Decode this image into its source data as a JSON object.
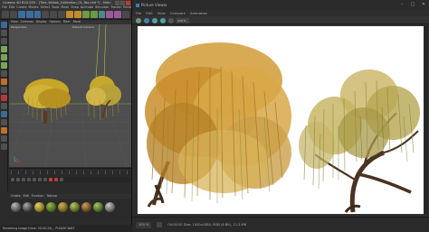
{
  "app": {
    "title": "Cinema 4D R20.059 - [Tree_Willow_Collection_01_fbx.c4d *] - Main",
    "menu": [
      "File",
      "Edit",
      "Create",
      "Modes",
      "Select",
      "Tools",
      "Mesh",
      "Snap",
      "Animate",
      "Simulate",
      "Tracker",
      "Render",
      "Sculpt",
      "Motion Tracker",
      "MoGraph",
      "Character",
      "Pipeline",
      "Plugins",
      "Script",
      "Window",
      "Help"
    ],
    "viewport": {
      "menu": [
        "View",
        "Cameras",
        "Display",
        "Options",
        "Filter",
        "Panel"
      ],
      "label": "Perspective",
      "camera": "Default Camera"
    },
    "material_menu": [
      "Create",
      "Edit",
      "Function",
      "Texture"
    ],
    "status": "Rendering Image (time: 00:00:20)... PLEASE WAIT"
  },
  "render_window": {
    "title": "Picture Viewer",
    "menu": [
      "File",
      "Edit",
      "View",
      "Compare",
      "Animation"
    ],
    "zoom_dropdown": "100 %",
    "status": {
      "zoom": "100 %",
      "info": "00:00:20 Size: 1920x1080, RGB (8 Bit), 11.3 MB"
    }
  }
}
